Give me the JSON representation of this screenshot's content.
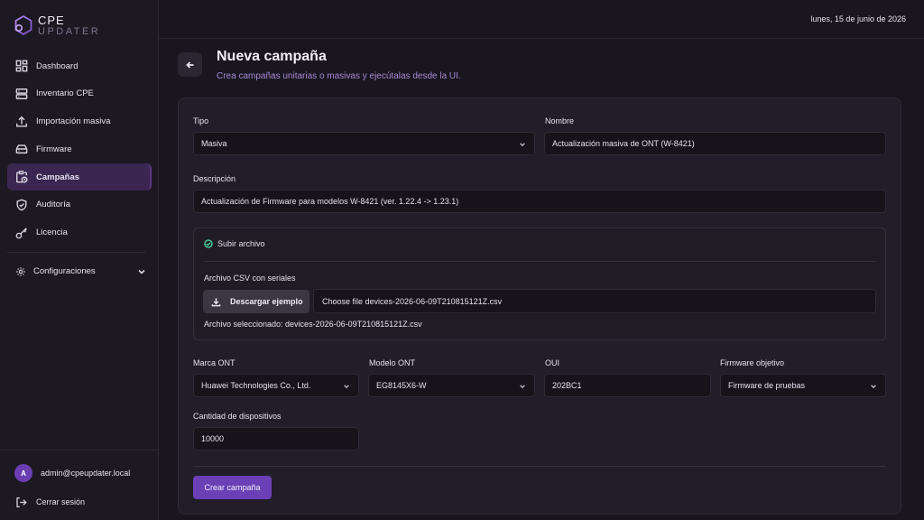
{
  "brand": {
    "line1": "CPE",
    "line2": "UPDATER"
  },
  "topbar": {
    "date": "lunes, 15 de junio de 2026"
  },
  "sidebar": {
    "items": [
      {
        "label": "Dashboard",
        "icon": "dashboard-icon"
      },
      {
        "label": "Inventario CPE",
        "icon": "server-icon"
      },
      {
        "label": "Importación masiva",
        "icon": "upload-icon"
      },
      {
        "label": "Firmware",
        "icon": "router-icon"
      },
      {
        "label": "Campañas",
        "icon": "clipboard-clock-icon",
        "active": true
      },
      {
        "label": "Auditoría",
        "icon": "shield-check-icon"
      },
      {
        "label": "Licencia",
        "icon": "key-icon"
      }
    ],
    "config_label": "Configuraciones",
    "user": {
      "initial": "A",
      "email": "admin@cpeupdater.local"
    },
    "logout_label": "Cerrar sesión"
  },
  "header": {
    "title": "Nueva campaña",
    "subtitle": "Crea campañas unitarias o masivas y ejecútalas desde la UI."
  },
  "form": {
    "tipo": {
      "label": "Tipo",
      "value": "Masiva"
    },
    "nombre": {
      "label": "Nombre",
      "value": "Actualización masiva de ONT (W-8421)"
    },
    "descripcion": {
      "label": "Descripción",
      "value": "Actualización de Firmware para modelos W-8421 (ver. 1.22.4 -> 1.23.1)"
    },
    "upload": {
      "mode_label": "Subir archivo",
      "csv_label": "Archivo CSV con seriales",
      "download_label": "Descargar ejemplo",
      "file_value": "Choose file devices-2026-06-09T210815121Z.csv",
      "selected_text": "Archivo seleccionado: devices-2026-06-09T210815121Z.csv"
    },
    "marca": {
      "label": "Marca ONT",
      "value": "Huawei Technologies Co., Ltd."
    },
    "modelo": {
      "label": "Modelo ONT",
      "value": "EG8145X6-W"
    },
    "oui": {
      "label": "OUI",
      "value": "202BC1"
    },
    "firmware": {
      "label": "Firmware objetivo",
      "value": "Firmware de pruebas"
    },
    "cantidad": {
      "label": "Cantidad de dispositivos",
      "value": "10000"
    },
    "submit_label": "Crear campaña"
  },
  "colors": {
    "accent": "#6b3fb5",
    "active_nav": "#3a2650",
    "success": "#49c08a"
  }
}
